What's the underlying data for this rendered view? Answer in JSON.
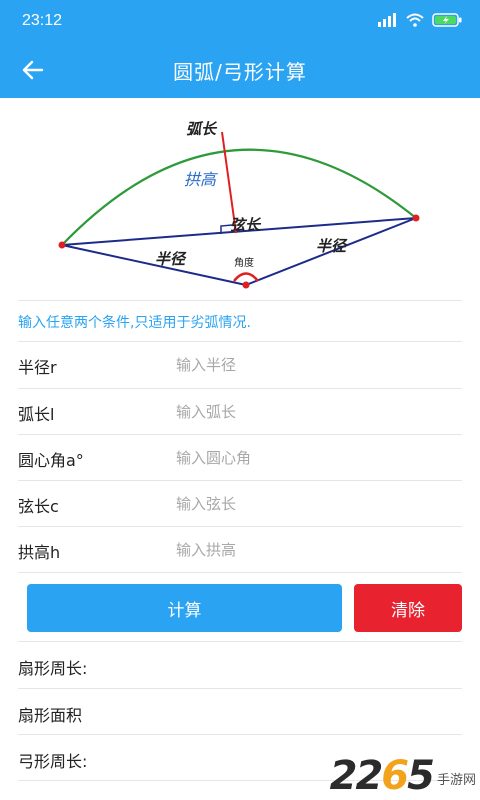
{
  "status_bar": {
    "time": "23:12"
  },
  "app_bar": {
    "title": "圆弧/弓形计算"
  },
  "diagram": {
    "arc_label": "弧长",
    "height_label": "拱高",
    "chord_label": "弦长",
    "radius_left_label": "半径",
    "radius_right_label": "半径",
    "angle_label": "角度"
  },
  "hint": "输入任意两个条件,只适用于劣弧情况.",
  "form": {
    "radius": {
      "label": "半径r",
      "placeholder": "输入半径"
    },
    "arc": {
      "label": "弧长l",
      "placeholder": "输入弧长"
    },
    "angle": {
      "label": "圆心角a°",
      "placeholder": "输入圆心角"
    },
    "chord": {
      "label": "弦长c",
      "placeholder": "输入弦长"
    },
    "height": {
      "label": "拱高h",
      "placeholder": "输入拱高"
    }
  },
  "buttons": {
    "calculate": "计算",
    "clear": "清除"
  },
  "results": {
    "sector_perimeter": "扇形周长:",
    "sector_area": "扇形面积",
    "segment_perimeter": "弓形周长:"
  },
  "watermark": {
    "number_a": "22",
    "number_b": "6",
    "number_c": "5",
    "site": "手游网"
  },
  "colors": {
    "primary": "#2aa3f2",
    "danger": "#e8232f",
    "arc": "#2e9a3a",
    "lines": "#1c2b8a",
    "marker": "#e02020"
  }
}
